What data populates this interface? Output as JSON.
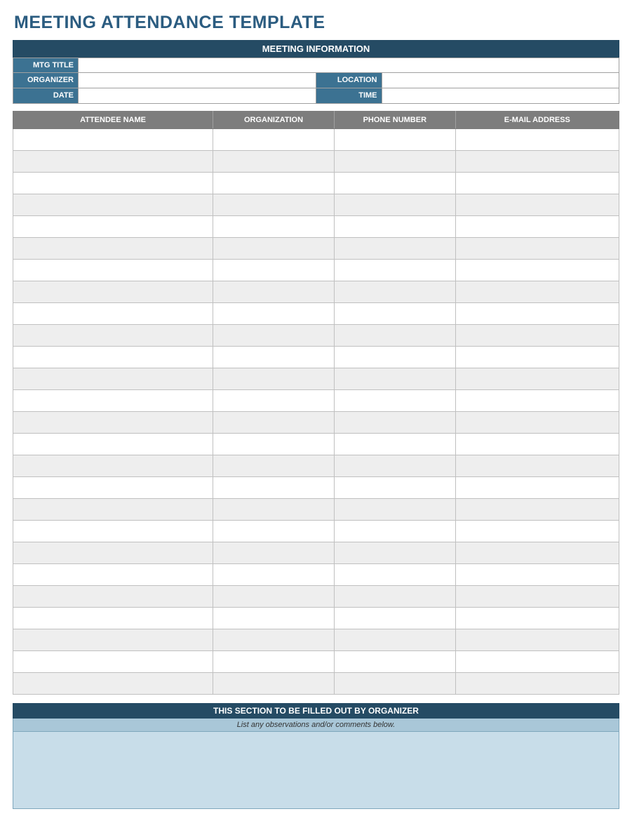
{
  "title": "MEETING ATTENDANCE TEMPLATE",
  "sections": {
    "info_header": "MEETING INFORMATION",
    "organizer_header": "THIS SECTION TO BE FILLED OUT BY ORGANIZER",
    "observations_instruction": "List any observations and/or comments below."
  },
  "labels": {
    "mtg_title": "MTG TITLE",
    "organizer": "ORGANIZER",
    "date": "DATE",
    "location": "LOCATION",
    "time": "TIME"
  },
  "fields": {
    "mtg_title": "",
    "organizer": "",
    "date": "",
    "location": "",
    "time": ""
  },
  "columns": {
    "attendee": "ATTENDEE NAME",
    "organization": "ORGANIZATION",
    "phone": "PHONE NUMBER",
    "email": "E-MAIL ADDRESS"
  },
  "attendees": [
    {
      "name": "",
      "organization": "",
      "phone": "",
      "email": ""
    },
    {
      "name": "",
      "organization": "",
      "phone": "",
      "email": ""
    },
    {
      "name": "",
      "organization": "",
      "phone": "",
      "email": ""
    },
    {
      "name": "",
      "organization": "",
      "phone": "",
      "email": ""
    },
    {
      "name": "",
      "organization": "",
      "phone": "",
      "email": ""
    },
    {
      "name": "",
      "organization": "",
      "phone": "",
      "email": ""
    },
    {
      "name": "",
      "organization": "",
      "phone": "",
      "email": ""
    },
    {
      "name": "",
      "organization": "",
      "phone": "",
      "email": ""
    },
    {
      "name": "",
      "organization": "",
      "phone": "",
      "email": ""
    },
    {
      "name": "",
      "organization": "",
      "phone": "",
      "email": ""
    },
    {
      "name": "",
      "organization": "",
      "phone": "",
      "email": ""
    },
    {
      "name": "",
      "organization": "",
      "phone": "",
      "email": ""
    },
    {
      "name": "",
      "organization": "",
      "phone": "",
      "email": ""
    },
    {
      "name": "",
      "organization": "",
      "phone": "",
      "email": ""
    },
    {
      "name": "",
      "organization": "",
      "phone": "",
      "email": ""
    },
    {
      "name": "",
      "organization": "",
      "phone": "",
      "email": ""
    },
    {
      "name": "",
      "organization": "",
      "phone": "",
      "email": ""
    },
    {
      "name": "",
      "organization": "",
      "phone": "",
      "email": ""
    },
    {
      "name": "",
      "organization": "",
      "phone": "",
      "email": ""
    },
    {
      "name": "",
      "organization": "",
      "phone": "",
      "email": ""
    },
    {
      "name": "",
      "organization": "",
      "phone": "",
      "email": ""
    },
    {
      "name": "",
      "organization": "",
      "phone": "",
      "email": ""
    },
    {
      "name": "",
      "organization": "",
      "phone": "",
      "email": ""
    },
    {
      "name": "",
      "organization": "",
      "phone": "",
      "email": ""
    },
    {
      "name": "",
      "organization": "",
      "phone": "",
      "email": ""
    },
    {
      "name": "",
      "organization": "",
      "phone": "",
      "email": ""
    }
  ],
  "observations": ""
}
